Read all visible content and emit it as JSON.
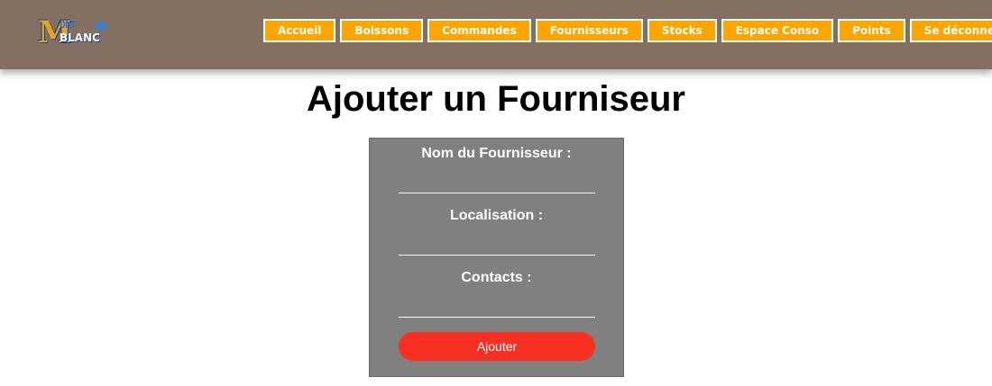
{
  "header": {
    "logo": {
      "letter": "M",
      "top_word": "ONT",
      "bottom_word": "BLANC"
    },
    "nav": [
      {
        "label": "Accueil"
      },
      {
        "label": "Boissons"
      },
      {
        "label": "Commandes"
      },
      {
        "label": "Fournisseurs"
      },
      {
        "label": "Stocks"
      },
      {
        "label": "Espace Conso"
      },
      {
        "label": "Points"
      },
      {
        "label": "Se déconnecter"
      }
    ]
  },
  "page": {
    "title": "Ajouter un Fourniseur"
  },
  "form": {
    "fields": [
      {
        "label": "Nom du Fournisseur :",
        "value": ""
      },
      {
        "label": "Localisation :",
        "value": ""
      },
      {
        "label": "Contacts :",
        "value": ""
      }
    ],
    "submit_label": "Ajouter"
  },
  "colors": {
    "header_bg": "#837062",
    "nav_button_bg": "#ffa500",
    "form_bg": "#808080",
    "submit_bg": "#f73022"
  }
}
